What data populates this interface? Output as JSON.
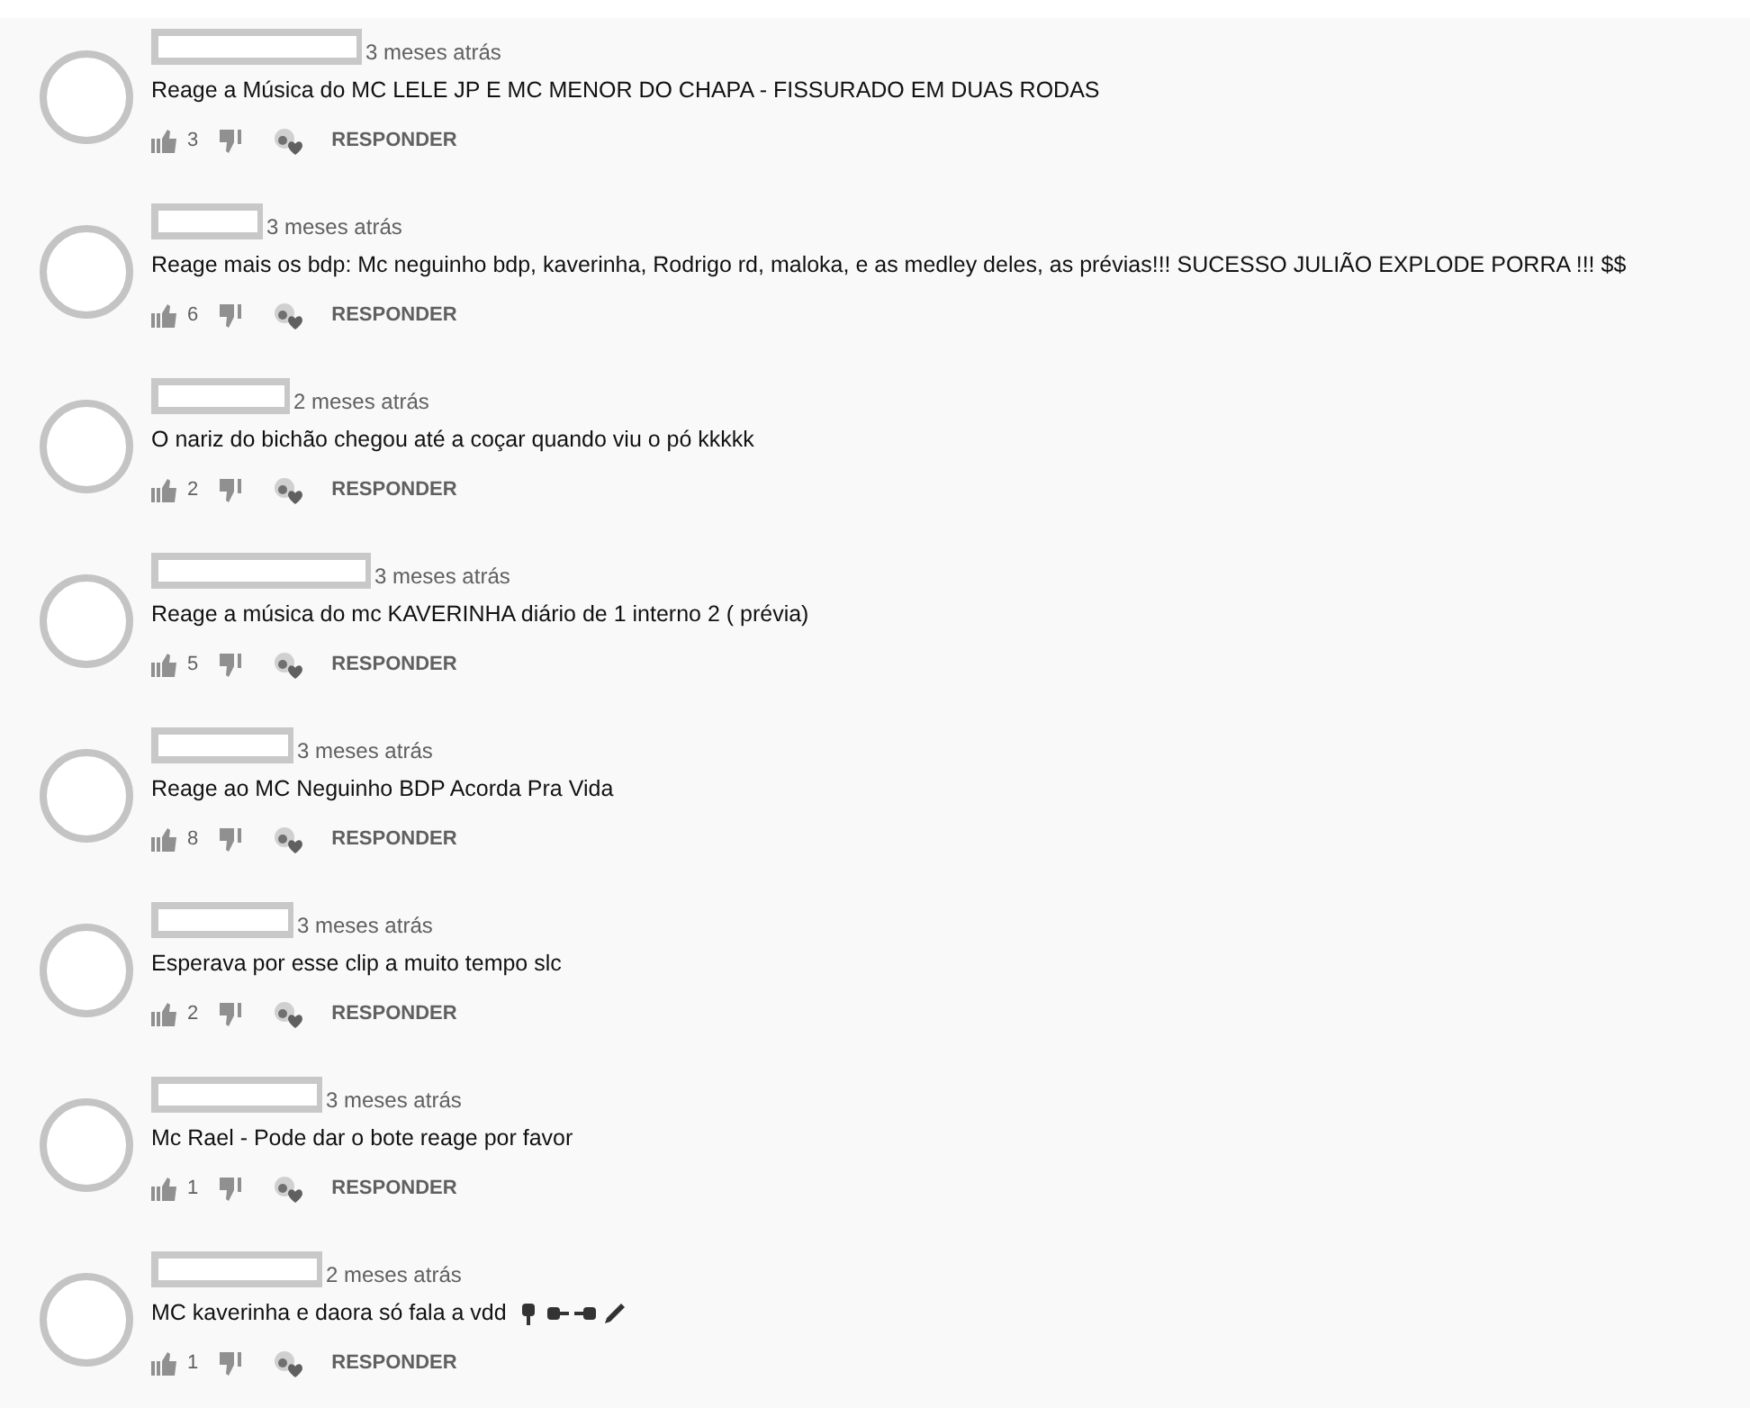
{
  "comments": [
    {
      "time": "3 meses atrás",
      "text": "Reage a Música do MC LELE JP E MC MENOR DO CHAPA - FISSURADO EM DUAS RODAS",
      "likes": "3",
      "reply": "RESPONDER"
    },
    {
      "time": "3 meses atrás",
      "text": "Reage mais os bdp: Mc neguinho bdp, kaverinha, Rodrigo rd, maloka, e as medley deles, as prévias!!! SUCESSO JULIÃO EXPLODE PORRA !!! $$",
      "likes": "6",
      "reply": "RESPONDER"
    },
    {
      "time": "2 meses atrás",
      "text": "O nariz do bichão chegou até a coçar quando viu o pó kkkkk",
      "likes": "2",
      "reply": "RESPONDER"
    },
    {
      "time": "3 meses atrás",
      "text": "Reage a música do mc KAVERINHA diário de 1 interno 2 ( prévia)",
      "likes": "5",
      "reply": "RESPONDER"
    },
    {
      "time": "3 meses atrás",
      "text": "Reage ao MC Neguinho BDP Acorda Pra Vida",
      "likes": "8",
      "reply": "RESPONDER"
    },
    {
      "time": "3 meses atrás",
      "text": "Esperava por esse clip a muito tempo slc",
      "likes": "2",
      "reply": "RESPONDER"
    },
    {
      "time": "3 meses atrás",
      "text": "Mc Rael - Pode dar o bote reage por favor",
      "likes": "1",
      "reply": "RESPONDER"
    },
    {
      "time": "2 meses atrás",
      "text": "MC kaverinha e daora só fala a vdd",
      "emoji": true,
      "likes": "1",
      "reply": "RESPONDER"
    }
  ]
}
